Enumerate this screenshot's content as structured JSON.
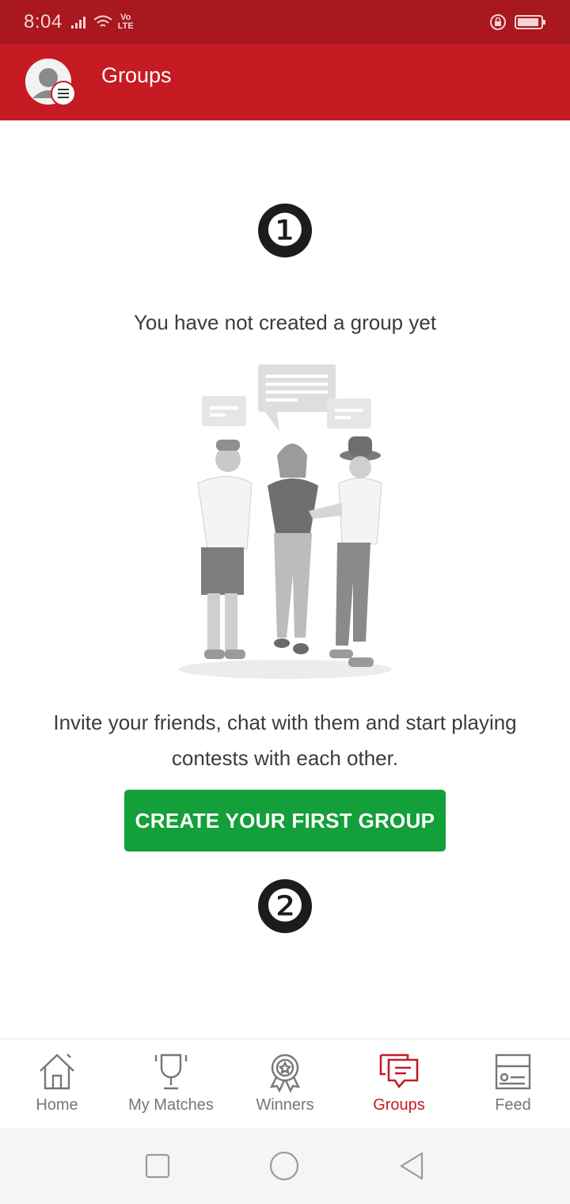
{
  "status_bar": {
    "time": "8:04",
    "network_label": "Vo\nLTE"
  },
  "header": {
    "title": "Groups"
  },
  "content": {
    "marker_1": "❶",
    "empty_title": "You have not created a group yet",
    "description": "Invite your friends, chat with them and start playing contests with each other.",
    "cta_label": "CREATE YOUR FIRST GROUP",
    "marker_2": "❷"
  },
  "bottom_nav": {
    "items": [
      {
        "label": "Home",
        "icon": "home-icon",
        "active": false
      },
      {
        "label": "My Matches",
        "icon": "trophy-icon",
        "active": false
      },
      {
        "label": "Winners",
        "icon": "award-icon",
        "active": false
      },
      {
        "label": "Groups",
        "icon": "chat-icon",
        "active": true
      },
      {
        "label": "Feed",
        "icon": "feed-icon",
        "active": false
      }
    ]
  },
  "colors": {
    "header": "#c61b22",
    "status_bar": "#a8181e",
    "cta": "#13a03a",
    "active": "#c61b22"
  }
}
